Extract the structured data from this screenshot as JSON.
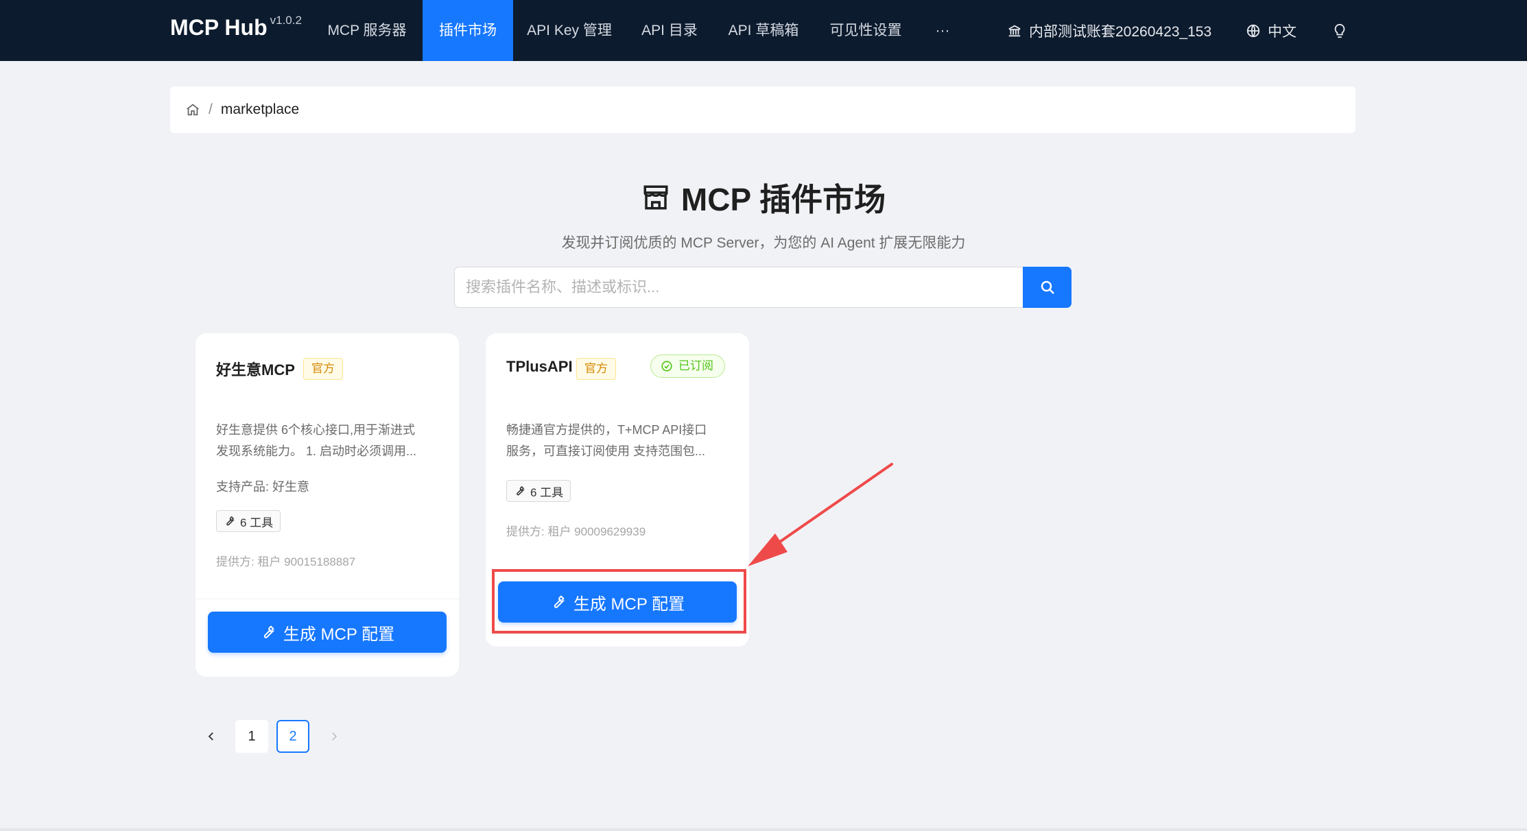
{
  "nav": {
    "brand": "MCP Hub",
    "version": "v1.0.2",
    "items": [
      {
        "label": "MCP 服务器"
      },
      {
        "label": "插件市场"
      },
      {
        "label": "API Key 管理"
      },
      {
        "label": "API 目录"
      },
      {
        "label": "API 草稿箱"
      },
      {
        "label": "可见性设置"
      },
      {
        "label": "···"
      }
    ],
    "active_item": "插件市场",
    "account": "内部测试账套20260423_153",
    "language": "中文"
  },
  "breadcrumb": {
    "current": "marketplace"
  },
  "header": {
    "title": "MCP 插件市场",
    "subtitle": "发现并订阅优质的 MCP Server，为您的 AI Agent 扩展无限能力"
  },
  "search": {
    "placeholder": "搜索插件名称、描述或标识...",
    "value": ""
  },
  "cards": [
    {
      "name": "好生意MCP",
      "badge": "官方",
      "description_line1": "好生意提供 6个核心接口,用于渐进式",
      "description_line2": "发现系统能力。 1. 启动时必须调用...",
      "product": "支持产品: 好生意",
      "tools": "6 工具",
      "provider": "提供方: 租户 90015188887",
      "button": "生成 MCP 配置"
    },
    {
      "name": "TPlusAPI",
      "badge": "官方",
      "status": "已订阅",
      "description_line1": "畅捷通官方提供的，T+MCP API接口",
      "description_line2": "服务，可直接订阅使用 支持范围包...",
      "tools": "6 工具",
      "provider": "提供方: 租户 90009629939",
      "button": "生成 MCP 配置"
    }
  ],
  "pagination": {
    "pages": [
      "1",
      "2"
    ],
    "current": "2"
  },
  "colors": {
    "nav_bg": "#0d1b2e",
    "primary": "#1677ff",
    "annotation": "#ef4a4a",
    "official_tag": "#d48806",
    "subscribed_tag": "#52c41a"
  }
}
